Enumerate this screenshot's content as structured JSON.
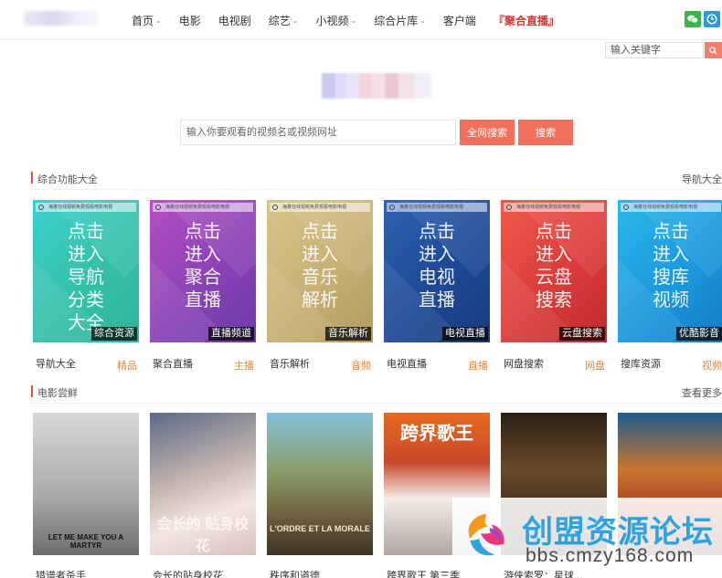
{
  "header": {
    "nav": [
      {
        "label": "首页",
        "dropdown": true
      },
      {
        "label": "电影",
        "dropdown": false
      },
      {
        "label": "电视剧",
        "dropdown": false
      },
      {
        "label": "综艺",
        "dropdown": true
      },
      {
        "label": "小视频",
        "dropdown": true
      },
      {
        "label": "综合片库",
        "dropdown": true
      },
      {
        "label": "客户端",
        "dropdown": false
      },
      {
        "label": "『聚合直播』",
        "dropdown": false
      }
    ],
    "icons": [
      "wechat-icon",
      "history-icon"
    ]
  },
  "keyword_search": {
    "placeholder": "输入关键字"
  },
  "main_search": {
    "placeholder": "输入你要观看的视频名或视频网址",
    "all_web_label": "全网搜索",
    "search_label": "搜索"
  },
  "features": {
    "title": "综合功能大全",
    "more": "导航大全",
    "cards": [
      {
        "big": [
          "点击",
          "进入",
          "导航",
          "分类",
          "大全"
        ],
        "tag": "综合资源",
        "caption": "导航大全",
        "sub": "精品"
      },
      {
        "big": [
          "点击",
          "进入",
          "聚合",
          "直播"
        ],
        "tag": "直播频道",
        "caption": "聚合直播",
        "sub": "主播"
      },
      {
        "big": [
          "点击",
          "进入",
          "音乐",
          "解析"
        ],
        "tag": "音乐解析",
        "caption": "音乐解析",
        "sub": "音频"
      },
      {
        "big": [
          "点击",
          "进入",
          "电视",
          "直播"
        ],
        "tag": "电视直播",
        "caption": "电视直播",
        "sub": "直播"
      },
      {
        "big": [
          "点击",
          "进入",
          "云盘",
          "搜索"
        ],
        "tag": "云盘搜索",
        "caption": "网盘搜索",
        "sub": "网盘"
      },
      {
        "big": [
          "点击",
          "进入",
          "搜库",
          "视频"
        ],
        "tag": "优酷影音",
        "caption": "搜库资源",
        "sub": "视频"
      }
    ],
    "search_strip_text": "海量在线视频免费观看电影电视"
  },
  "movies": {
    "title": "电影尝鲜",
    "more": "查看更多",
    "items": [
      {
        "title": "猎谱者杀手",
        "poster_text": "LET ME MAKE YOU A MARTYR"
      },
      {
        "title": "会长的贴身校花",
        "poster_text": "会长的 贴身校花"
      },
      {
        "title": "秩序和道德",
        "poster_text": "L'ORDRE ET LA MORALE"
      },
      {
        "title": "跨界歌王 第三季",
        "poster_text": "跨界歌王"
      },
      {
        "title": "游侠索罗：星球...",
        "poster_text": ""
      },
      {
        "title": "",
        "poster_text": ""
      }
    ]
  },
  "watermark": {
    "title": "创盟资源论坛",
    "url": "bbs.cmzy168.com"
  },
  "colors": {
    "accent": "#f3705c",
    "live": "#e03131",
    "sub": "#e8852f",
    "section_bar": "#e8542f"
  }
}
